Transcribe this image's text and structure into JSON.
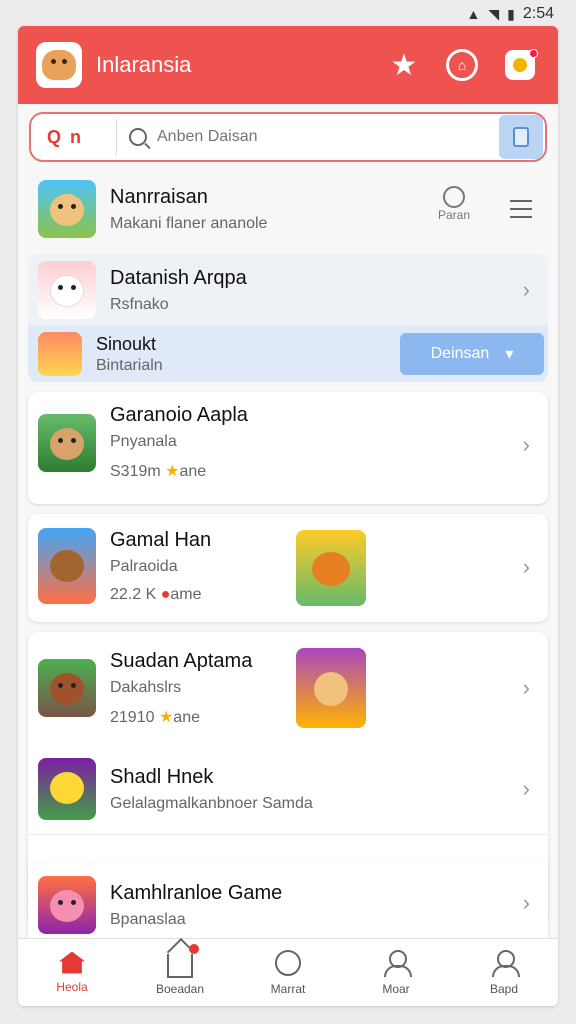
{
  "status_bar": {
    "time": "2:54"
  },
  "header": {
    "title": "Inlaransia"
  },
  "search": {
    "filter_label": "Q n",
    "placeholder": "Anben Daisan"
  },
  "items": [
    {
      "title": "Nanrraisan",
      "subtitle": "Makani flaner ananole",
      "action_label": "Paran"
    },
    {
      "title": "Datanish Arqpa",
      "subtitle": "Rsfnako"
    },
    {
      "title": "Sinoukt",
      "subtitle": "Bintarialn",
      "button_label": "Deinsan"
    },
    {
      "title": "Garanoio Aapla",
      "subtitle": "Pnyanala",
      "meta": "S319m",
      "meta_suffix": "ane"
    },
    {
      "title": "Gamal Han",
      "subtitle": "Palraoida",
      "meta": "22.2 K",
      "meta_suffix": "ame"
    },
    {
      "title": "Suadan Aptama",
      "subtitle": "Dakahslrs",
      "meta": "21910",
      "meta_suffix": "ane"
    },
    {
      "title": "Shadl Hnek",
      "subtitle": "Gelalagmalkanbnoer Samda"
    },
    {
      "title": "Kamhlranloe Game",
      "subtitle": "Bpanaslaa"
    }
  ],
  "nav": [
    {
      "label": "Heola"
    },
    {
      "label": "Boeadan"
    },
    {
      "label": "Marrat"
    },
    {
      "label": "Moar"
    },
    {
      "label": "Bapd"
    }
  ]
}
